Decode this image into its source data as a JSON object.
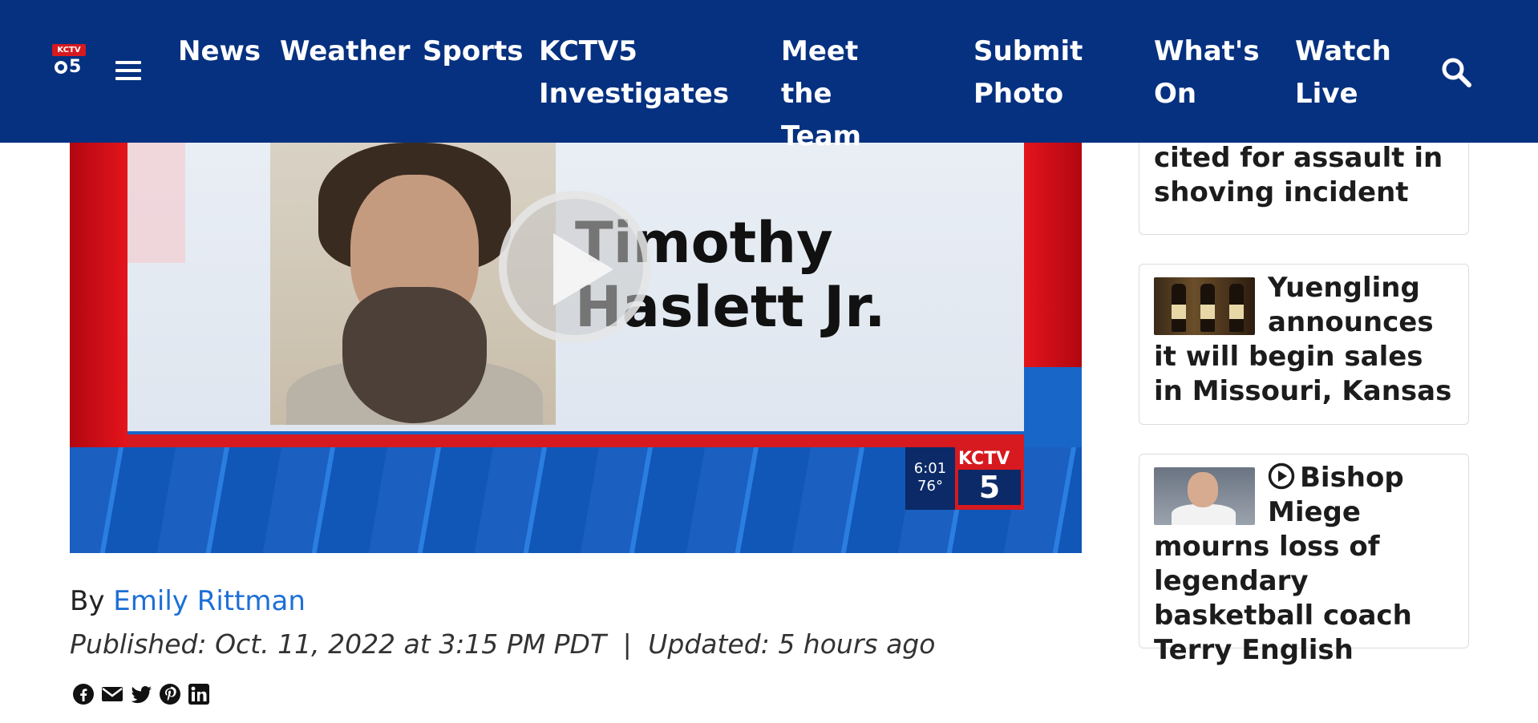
{
  "header": {
    "logo_tag": "KCTV",
    "logo_num": "5",
    "nav": [
      "News",
      "Weather",
      "Sports",
      "KCTV5 Investigates",
      "Meet the Team",
      "Submit Photo",
      "What's On",
      "Watch Live"
    ]
  },
  "video": {
    "name_line1": "Timothy",
    "name_line2": "Haslett Jr.",
    "bug_time": "6:01",
    "bug_temp": "76°",
    "bug_brand": "KCTV",
    "bug_num": "5"
  },
  "article": {
    "byline_prefix": "By",
    "author": "Emily Rittman",
    "published": "Published: Oct. 11, 2022 at 3:15 PM PDT",
    "separator": "|",
    "updated": "Updated: 5 hours ago"
  },
  "sidebar": {
    "cards": [
      {
        "title": "Davante Adams cited for assault in shoving incident"
      },
      {
        "title": "Yuengling announces it will begin sales in Missouri, Kansas"
      },
      {
        "title": "Bishop Miege mourns loss of legendary basketball coach Terry English",
        "has_video": true
      }
    ]
  },
  "colors": {
    "header_bg": "#063180",
    "link": "#1d6fd6",
    "brand_red": "#d71920"
  }
}
